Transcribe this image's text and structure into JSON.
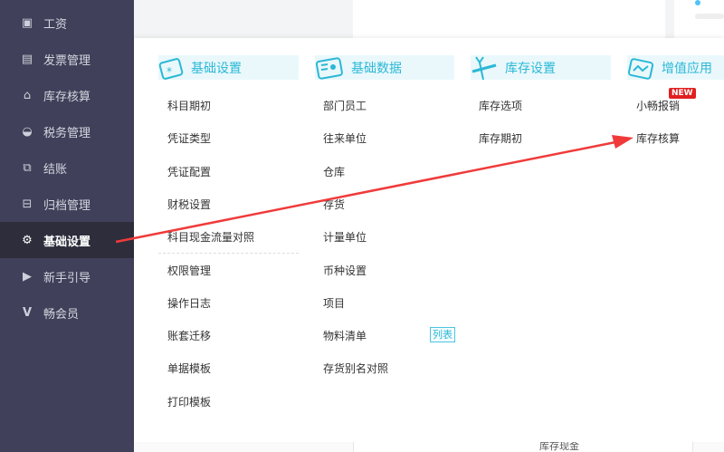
{
  "sidebar": {
    "items": [
      {
        "label": "工资",
        "icon": "salary-icon"
      },
      {
        "label": "发票管理",
        "icon": "invoice-icon"
      },
      {
        "label": "库存核算",
        "icon": "warehouse-icon"
      },
      {
        "label": "税务管理",
        "icon": "tax-icon"
      },
      {
        "label": "结账",
        "icon": "checkout-icon"
      },
      {
        "label": "归档管理",
        "icon": "archive-icon"
      },
      {
        "label": "基础设置",
        "icon": "gear-icon",
        "active": true
      },
      {
        "label": "新手引导",
        "icon": "video-icon"
      },
      {
        "label": "畅会员",
        "icon": "vip-icon"
      }
    ]
  },
  "menu": {
    "columns": [
      {
        "title": "基础设置",
        "icon": "settings-card-icon",
        "items": [
          "科目期初",
          "凭证类型",
          "凭证配置",
          "财税设置",
          "科目现金流量对照",
          "权限管理",
          "操作日志",
          "账套迁移",
          "单据模板",
          "打印模板"
        ]
      },
      {
        "title": "基础数据",
        "icon": "id-card-icon",
        "items": [
          "部门员工",
          "往来单位",
          "仓库",
          "存货",
          "计量单位",
          "币种设置",
          "项目",
          "物料清单",
          "存货别名对照"
        ],
        "tag": "列表"
      },
      {
        "title": "库存设置",
        "icon": "wrench-icon",
        "items": [
          "库存选项",
          "库存期初"
        ]
      },
      {
        "title": "增值应用",
        "icon": "chart-bag-icon",
        "items": [
          "小畅报销",
          "库存核算"
        ],
        "badge": "NEW"
      }
    ]
  },
  "background": {
    "bottom_cell": "库存现金"
  },
  "colors": {
    "sidebar": "#40405a",
    "sidebar_active": "#2d2d3c",
    "accent": "#2bb8d6",
    "annotation_arrow": "#f03a3a",
    "badge": "#e02020"
  }
}
